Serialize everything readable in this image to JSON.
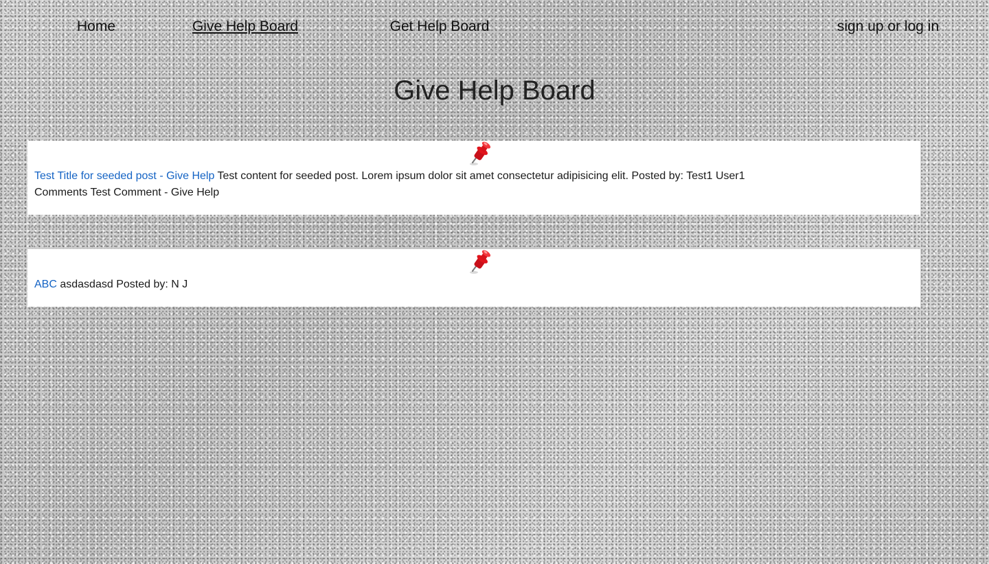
{
  "nav": {
    "home": "Home",
    "give_help_board": "Give Help Board",
    "get_help_board": "Get Help Board",
    "sign_up_or_log_in": "sign up or log in"
  },
  "page": {
    "title": "Give Help Board"
  },
  "posts": [
    {
      "title": "Test Title for seeded post - Give Help",
      "content": "Test content for seeded post. Lorem ipsum dolor sit amet consectetur adipisicing elit.",
      "posted_by_label": "Posted by:",
      "author": "Test1 User1",
      "comments_label": "Comments",
      "comment": "Test Comment - Give Help"
    },
    {
      "title": "ABC",
      "content": "asdasdasd",
      "posted_by_label": "Posted by:",
      "author": "N J"
    }
  ],
  "colors": {
    "link": "#1463c4",
    "pin": "#e0141c",
    "card": "#ffffff"
  },
  "icons": {
    "pin": "pushpin-icon"
  }
}
